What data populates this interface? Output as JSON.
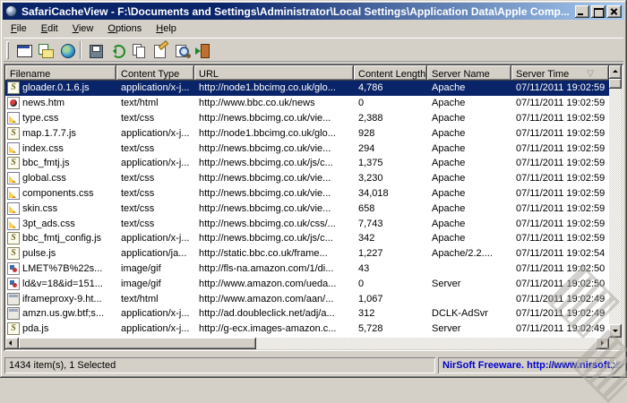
{
  "window": {
    "title": "SafariCacheView - F:\\Documents and Settings\\Administrator\\Local Settings\\Application Data\\Apple Comp..."
  },
  "menu": {
    "items": [
      {
        "label": "File",
        "underline": 0
      },
      {
        "label": "Edit",
        "underline": 0
      },
      {
        "label": "View",
        "underline": 0
      },
      {
        "label": "Options",
        "underline": 0
      },
      {
        "label": "Help",
        "underline": 0
      }
    ]
  },
  "icons": {
    "app": "safari-cache-app-icon",
    "window_controls": [
      "minimize-icon",
      "maximize-icon",
      "close-icon"
    ],
    "toolbar": [
      "open-cache-window-icon",
      "copy-to-folder-icon",
      "globe-icon",
      "save-icon",
      "refresh-icon",
      "copy-icon",
      "properties-icon",
      "find-icon",
      "exit-icon"
    ],
    "sort": "sort-descending-icon",
    "row_icon_types": {
      "js": "script-file-icon",
      "html": "html-file-icon",
      "css": "css-file-icon",
      "img": "image-file-icon",
      "win": "web-window-icon"
    }
  },
  "table": {
    "columns": [
      {
        "label": "Filename"
      },
      {
        "label": "Content Type"
      },
      {
        "label": "URL"
      },
      {
        "label": "Content Length"
      },
      {
        "label": "Server Name"
      },
      {
        "label": "Server Time"
      }
    ],
    "sort_column": "Server Time",
    "sort_direction": "descending",
    "rows": [
      {
        "icon": "js",
        "selected": true,
        "filename": "gloader.0.1.6.js",
        "content_type": "application/x-j...",
        "url": "http://node1.bbcimg.co.uk/glo...",
        "content_length": "4,786",
        "server_name": "Apache",
        "server_time": "07/11/2011 19:02:59"
      },
      {
        "icon": "html",
        "selected": false,
        "filename": "news.htm",
        "content_type": "text/html",
        "url": "http://www.bbc.co.uk/news",
        "content_length": "0",
        "server_name": "Apache",
        "server_time": "07/11/2011 19:02:59"
      },
      {
        "icon": "css",
        "selected": false,
        "filename": "type.css",
        "content_type": "text/css",
        "url": "http://news.bbcimg.co.uk/vie...",
        "content_length": "2,388",
        "server_name": "Apache",
        "server_time": "07/11/2011 19:02:59"
      },
      {
        "icon": "js",
        "selected": false,
        "filename": "map.1.7.7.js",
        "content_type": "application/x-j...",
        "url": "http://node1.bbcimg.co.uk/glo...",
        "content_length": "928",
        "server_name": "Apache",
        "server_time": "07/11/2011 19:02:59"
      },
      {
        "icon": "css",
        "selected": false,
        "filename": "index.css",
        "content_type": "text/css",
        "url": "http://news.bbcimg.co.uk/vie...",
        "content_length": "294",
        "server_name": "Apache",
        "server_time": "07/11/2011 19:02:59"
      },
      {
        "icon": "js",
        "selected": false,
        "filename": "bbc_fmtj.js",
        "content_type": "application/x-j...",
        "url": "http://news.bbcimg.co.uk/js/c...",
        "content_length": "1,375",
        "server_name": "Apache",
        "server_time": "07/11/2011 19:02:59"
      },
      {
        "icon": "css",
        "selected": false,
        "filename": "global.css",
        "content_type": "text/css",
        "url": "http://news.bbcimg.co.uk/vie...",
        "content_length": "3,230",
        "server_name": "Apache",
        "server_time": "07/11/2011 19:02:59"
      },
      {
        "icon": "css",
        "selected": false,
        "filename": "components.css",
        "content_type": "text/css",
        "url": "http://news.bbcimg.co.uk/vie...",
        "content_length": "34,018",
        "server_name": "Apache",
        "server_time": "07/11/2011 19:02:59"
      },
      {
        "icon": "css",
        "selected": false,
        "filename": "skin.css",
        "content_type": "text/css",
        "url": "http://news.bbcimg.co.uk/vie...",
        "content_length": "658",
        "server_name": "Apache",
        "server_time": "07/11/2011 19:02:59"
      },
      {
        "icon": "css",
        "selected": false,
        "filename": "3pt_ads.css",
        "content_type": "text/css",
        "url": "http://news.bbcimg.co.uk/css/...",
        "content_length": "7,743",
        "server_name": "Apache",
        "server_time": "07/11/2011 19:02:59"
      },
      {
        "icon": "js",
        "selected": false,
        "filename": "bbc_fmtj_config.js",
        "content_type": "application/x-j...",
        "url": "http://news.bbcimg.co.uk/js/c...",
        "content_length": "342",
        "server_name": "Apache",
        "server_time": "07/11/2011 19:02:59"
      },
      {
        "icon": "js",
        "selected": false,
        "filename": "pulse.js",
        "content_type": "application/ja...",
        "url": "http://static.bbc.co.uk/frame...",
        "content_length": "1,227",
        "server_name": "Apache/2.2....",
        "server_time": "07/11/2011 19:02:54"
      },
      {
        "icon": "img",
        "selected": false,
        "filename": "LMET%7B%22s...",
        "content_type": "image/gif",
        "url": "http://fls-na.amazon.com/1/di...",
        "content_length": "43",
        "server_name": "",
        "server_time": "07/11/2011 19:02:50"
      },
      {
        "icon": "img",
        "selected": false,
        "filename": "ld&v=18&id=151...",
        "content_type": "image/gif",
        "url": "http://www.amazon.com/ueda...",
        "content_length": "0",
        "server_name": "Server",
        "server_time": "07/11/2011 19:02:50"
      },
      {
        "icon": "win",
        "selected": false,
        "filename": "iframeproxy-9.ht...",
        "content_type": "text/html",
        "url": "http://www.amazon.com/aan/...",
        "content_length": "1,067",
        "server_name": "",
        "server_time": "07/11/2011 19:02:49"
      },
      {
        "icon": "win",
        "selected": false,
        "filename": "amzn.us.gw.btf;s...",
        "content_type": "application/x-j...",
        "url": "http://ad.doubleclick.net/adj/a...",
        "content_length": "312",
        "server_name": "DCLK-AdSvr",
        "server_time": "07/11/2011 19:02:49"
      },
      {
        "icon": "js",
        "selected": false,
        "filename": "pda.js",
        "content_type": "application/x-j...",
        "url": "http://g-ecx.images-amazon.c...",
        "content_length": "5,728",
        "server_name": "Server",
        "server_time": "07/11/2011 19:02:49"
      }
    ]
  },
  "status": {
    "left": "1434 item(s), 1 Selected",
    "right": "NirSoft Freeware.  http://www.nirsoft.net"
  },
  "watermark": {
    "text": "INSTALUJ.CZ"
  },
  "colors": {
    "selection": "#0a246a",
    "titlebar_gradient_start": "#0a246a",
    "titlebar_gradient_end": "#a6caf0",
    "button_face": "#d4d0c8",
    "status_link": "#0000cc"
  }
}
